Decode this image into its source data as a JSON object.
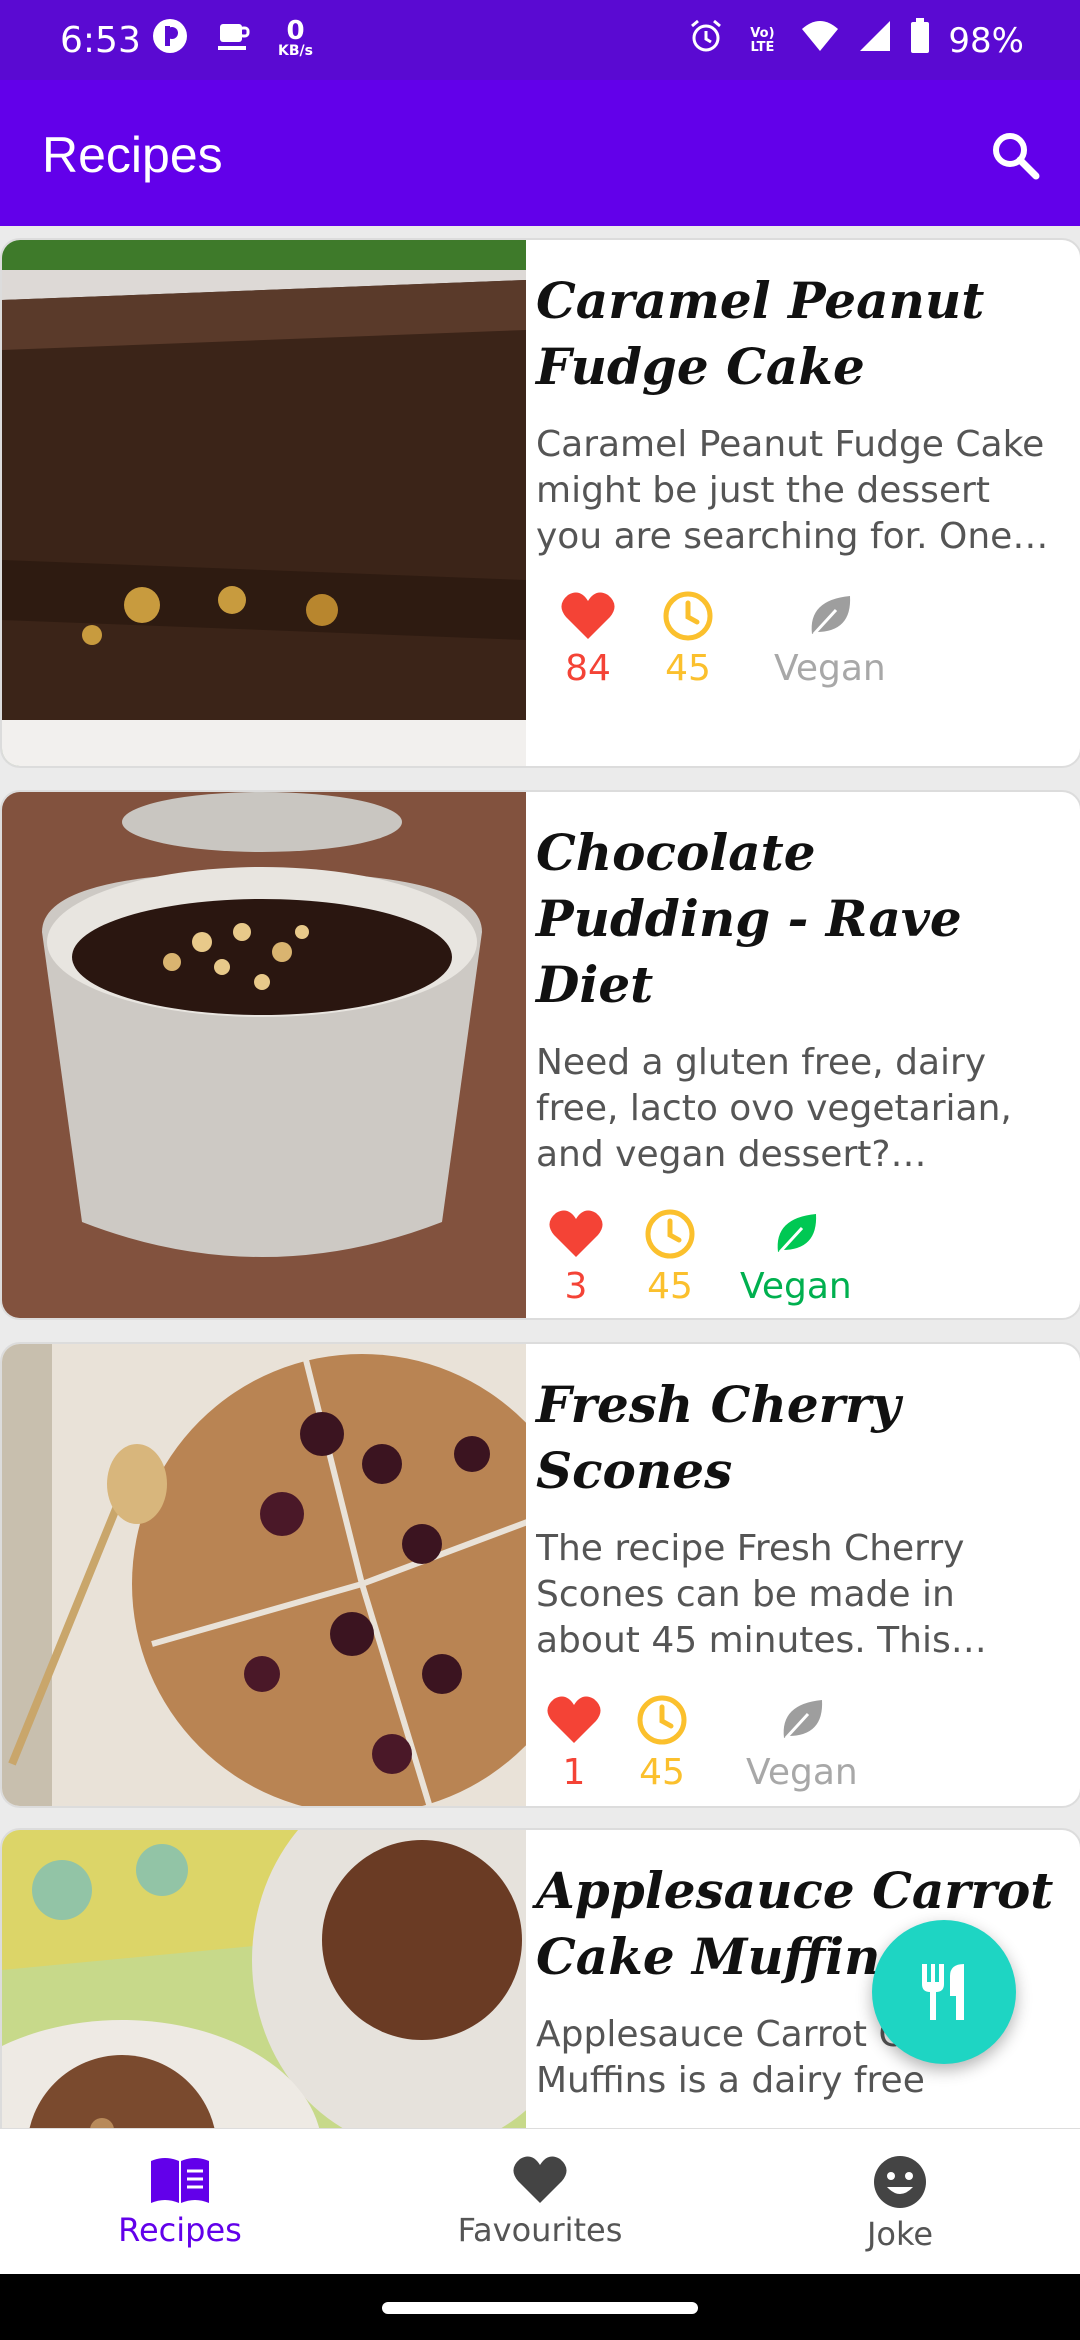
{
  "status_bar": {
    "time": "6:53",
    "data_speed": "0",
    "data_unit": "KB/s",
    "network": "Vo) LTE",
    "battery": "98%"
  },
  "app_bar": {
    "title": "Recipes"
  },
  "recipes": [
    {
      "title": "Caramel Peanut Fudge Cake",
      "description": "Caramel Peanut Fudge Cake might be just the dessert you are searching for. One p...",
      "likes": "84",
      "minutes": "45",
      "vegan_label": "Vegan",
      "is_vegan": false
    },
    {
      "title": "Chocolate Pudding - Rave Diet",
      "description": "Need a gluten free, dairy free, lacto ovo vegetarian, and vegan dessert? Chocolate P...",
      "likes": "3",
      "minutes": "45",
      "vegan_label": "Vegan",
      "is_vegan": true
    },
    {
      "title": "Fresh Cherry Scones",
      "description": "The recipe Fresh Cherry Scones can be made in about 45 minutes. This gluten free ...",
      "likes": "1",
      "minutes": "45",
      "vegan_label": "Vegan",
      "is_vegan": false
    },
    {
      "title": "Applesauce Carrot Cake Muffins",
      "description": "Applesauce Carrot Cake Muffins is a dairy free"
    }
  ],
  "bottom_nav": {
    "items": [
      {
        "label": "Recipes",
        "icon": "book-icon",
        "active": true
      },
      {
        "label": "Favourites",
        "icon": "heart-icon",
        "active": false
      },
      {
        "label": "Joke",
        "icon": "smiley-icon",
        "active": false
      }
    ]
  },
  "colors": {
    "status_bar": "#5a0ad2",
    "app_bar": "#6200ea",
    "accent": "#6200ea",
    "like": "#f44336",
    "time": "#fbc02d",
    "vegan_on": "#00c853",
    "vegan_off": "#9e9e9e",
    "fab": "#1ed5c3"
  }
}
